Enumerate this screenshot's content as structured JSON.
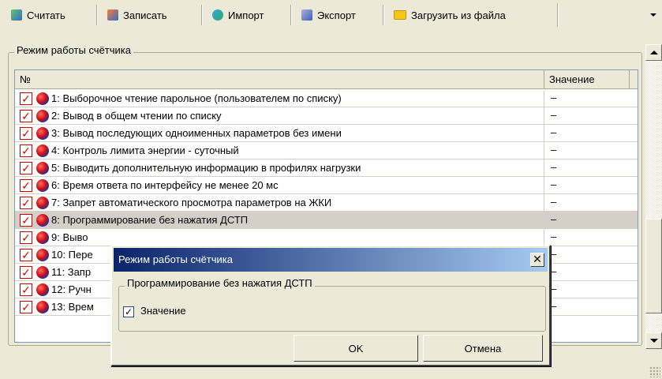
{
  "toolbar": {
    "buttons": [
      {
        "label": "Считать",
        "icon": "read-icon"
      },
      {
        "label": "Записать",
        "icon": "write-icon"
      },
      {
        "label": "Импорт",
        "icon": "import-icon"
      },
      {
        "label": "Экспорт",
        "icon": "export-icon"
      },
      {
        "label": "Загрузить из файла",
        "icon": "folder-icon"
      }
    ]
  },
  "group": {
    "title": "Режим работы счётчика"
  },
  "table": {
    "headers": {
      "no": "№",
      "value": "Значение"
    },
    "rows": [
      {
        "text": "1: Выборочное чтение парольное (пользователем по списку)",
        "value": "–",
        "checked": true
      },
      {
        "text": "2: Вывод в общем чтении по списку",
        "value": "–",
        "checked": true
      },
      {
        "text": "3: Вывод последующих одноименных параметров без имени",
        "value": "–",
        "checked": true
      },
      {
        "text": "4: Контроль лимита энергии - суточный",
        "value": "–",
        "checked": true
      },
      {
        "text": "5: Выводить дополнительную информацию в профилях нагрузки",
        "value": "–",
        "checked": true
      },
      {
        "text": "6: Время ответа по интерфейсу не менее 20 мс",
        "value": "–",
        "checked": true
      },
      {
        "text": "7: Запрет автоматического просмотра параметров на ЖКИ",
        "value": "–",
        "checked": true
      },
      {
        "text": "8: Программирование без нажатия ДСТП",
        "value": "–",
        "checked": true,
        "selected": true
      },
      {
        "text": "9: Выво",
        "value": "–",
        "checked": true
      },
      {
        "text": "10: Пере",
        "value": "–",
        "checked": true
      },
      {
        "text": "11: Запр",
        "value": "–",
        "checked": true
      },
      {
        "text": "12: Ручн",
        "value": "–",
        "checked": true
      },
      {
        "text": "13: Врем",
        "value": "–",
        "checked": true
      }
    ]
  },
  "dialog": {
    "title": "Режим работы счётчика",
    "close": "✕",
    "group_title": "Программирование без нажатия ДСТП",
    "checkbox_label": "Значение",
    "checkbox_checked": true,
    "ok": "OK",
    "cancel": "Отмена"
  }
}
